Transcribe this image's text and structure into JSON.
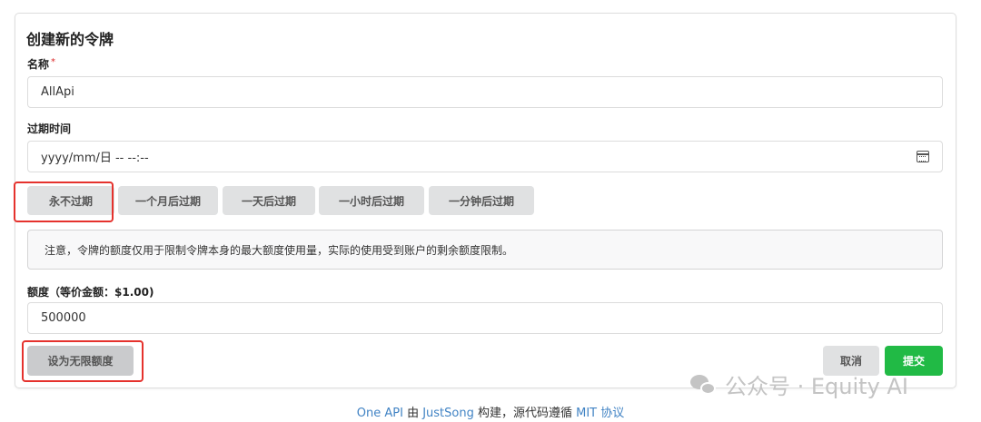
{
  "form": {
    "title": "创建新的令牌",
    "name_label": "名称",
    "name_required_mark": "*",
    "name_value": "AllApi",
    "expiry_label": "过期时间",
    "expiry_value": "yyyy/mm/日 -- --:--",
    "expiry_buttons": [
      "永不过期",
      "一个月后过期",
      "一天后过期",
      "一小时后过期",
      "一分钟后过期"
    ],
    "notice": "注意，令牌的额度仅用于限制令牌本身的最大额度使用量，实际的使用受到账户的剩余额度限制。",
    "quota_label": "额度（等价金额：$1.00)",
    "quota_value": "500000",
    "unlimited_button": "设为无限额度",
    "cancel_button": "取消",
    "submit_button": "提交"
  },
  "watermark": {
    "text": "公众号 · Equity AI",
    "icon": "wechat-icon"
  },
  "footer": {
    "part1": "One API",
    "part2": " 由 ",
    "part3": "JustSong",
    "part4": " 构建，源代码遵循 ",
    "part5": "MIT 协议"
  },
  "colors": {
    "submit": "#21ba45",
    "highlight": "#e5322d",
    "link": "#4183c4"
  }
}
